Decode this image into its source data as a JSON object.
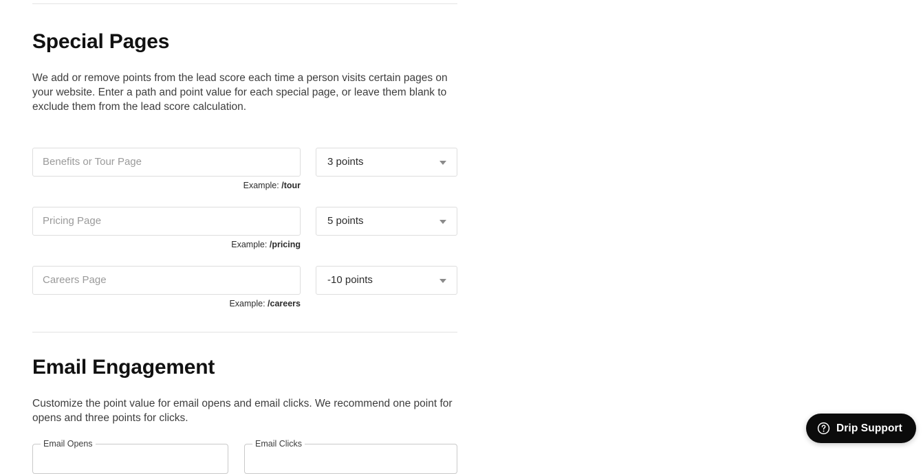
{
  "theme": {
    "background": "#ffffff",
    "heading_color": "#111111",
    "body_text_color": "#3d3d3d",
    "border_color": "#dddddd",
    "divider_color": "#e3e3e3",
    "placeholder_color": "#9a9a9a",
    "widget_background": "#0b0b0b",
    "widget_text_color": "#ffffff"
  },
  "special_pages": {
    "title": "Special Pages",
    "description": "We add or remove points from the lead score each time a person visits certain pages on your website. Enter a path and point value for each special page, or leave them blank to exclude them from the lead score calculation.",
    "rows": [
      {
        "placeholder": "Benefits or Tour Page",
        "value": "",
        "points": "3 points",
        "example_label": "Example:",
        "example_path": "/tour"
      },
      {
        "placeholder": "Pricing Page",
        "value": "",
        "points": "5 points",
        "example_label": "Example:",
        "example_path": "/pricing"
      },
      {
        "placeholder": "Careers Page",
        "value": "",
        "points": "-10 points",
        "example_label": "Example:",
        "example_path": "/careers"
      }
    ]
  },
  "email_engagement": {
    "title": "Email Engagement",
    "description": "Customize the point value for email opens and email clicks. We recommend one point for opens and three points for clicks.",
    "fields": [
      {
        "label": "Email Opens",
        "value": ""
      },
      {
        "label": "Email Clicks",
        "value": ""
      }
    ]
  },
  "support_widget": {
    "label": "Drip Support",
    "icon": "question-circle-icon"
  }
}
